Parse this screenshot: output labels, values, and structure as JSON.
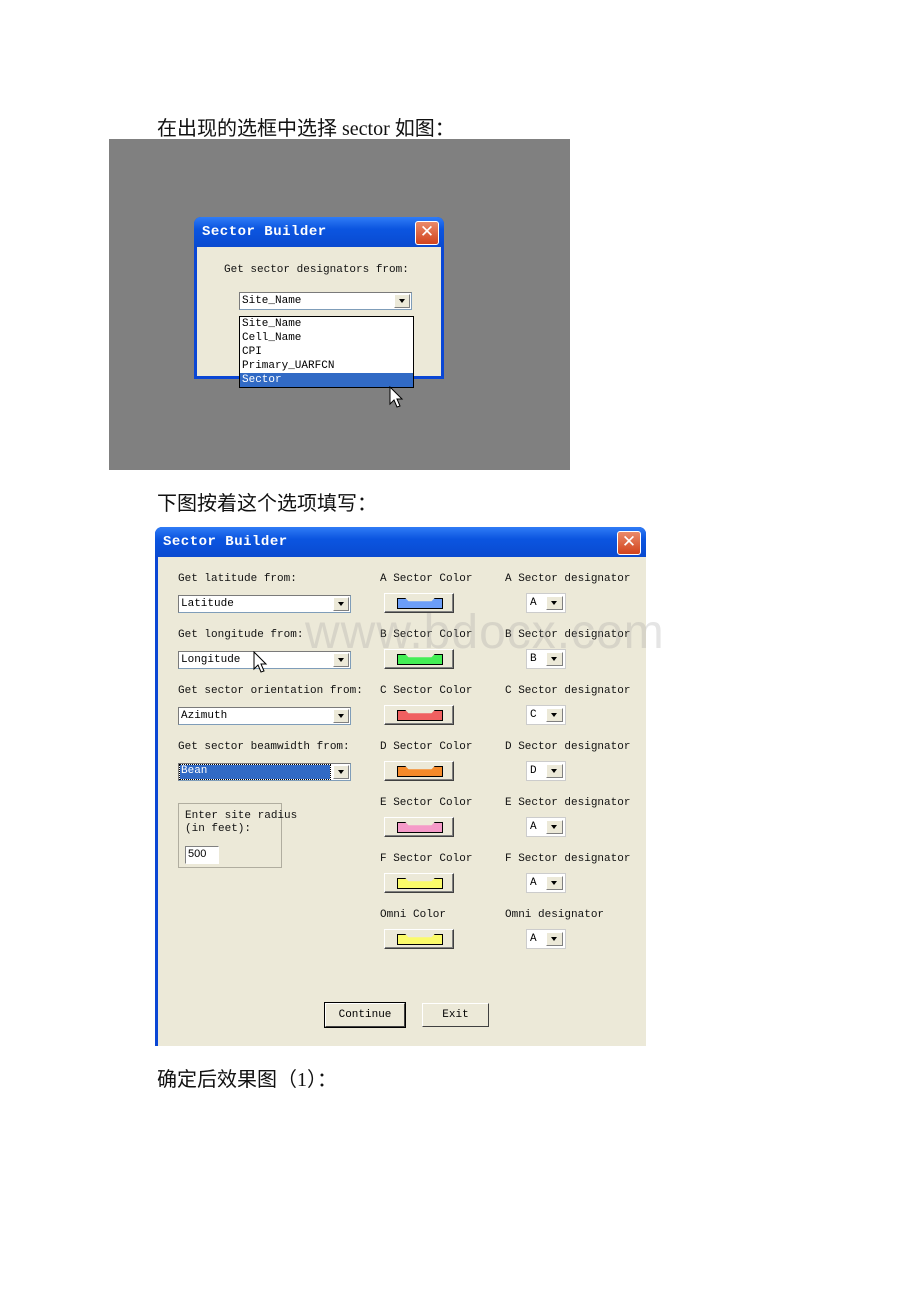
{
  "captions": {
    "intro": "在出现的选框中选择 sector 如图：",
    "fill": "下图按着这个选项填写：",
    "result": "确定后效果图（1）："
  },
  "dialog1": {
    "title": "Sector Builder",
    "close_icon": "close-icon",
    "label": "Get sector designators from:",
    "combo_value": "Site_Name",
    "options": [
      "Site_Name",
      "Cell_Name",
      "CPI",
      "Primary_UARFCN",
      "Sector"
    ],
    "highlighted": "Sector"
  },
  "dialog2": {
    "title": "Sector Builder",
    "close_icon": "close-icon",
    "left": {
      "latitude_label": "Get latitude from:",
      "latitude_value": "Latitude",
      "longitude_label": "Get longitude from:",
      "longitude_value": "Longitude",
      "orientation_label": "Get sector orientation from:",
      "orientation_value": "Azimuth",
      "beamwidth_label": "Get sector beamwidth from:",
      "beamwidth_value": "Bean",
      "radius_label_1": "Enter site radius",
      "radius_label_2": "(in feet):",
      "radius_value": "500"
    },
    "sectors": [
      {
        "color_label": "A Sector Color",
        "color": "#6c9ef8",
        "designator_label": "A Sector designator",
        "designator": "A"
      },
      {
        "color_label": "B Sector Color",
        "color": "#44ee55",
        "designator_label": "B Sector designator",
        "designator": "B"
      },
      {
        "color_label": "C Sector Color",
        "color": "#f06060",
        "designator_label": "C Sector designator",
        "designator": "C"
      },
      {
        "color_label": "D Sector Color",
        "color": "#f58a2a",
        "designator_label": "D Sector designator",
        "designator": "D"
      },
      {
        "color_label": "E Sector Color",
        "color": "#f59ac8",
        "designator_label": "E Sector designator",
        "designator": "A"
      },
      {
        "color_label": "F Sector Color",
        "color": "#fbfb6a",
        "designator_label": "F Sector designator",
        "designator": "A"
      },
      {
        "color_label": "Omni Color",
        "color": "#fbfb6a",
        "designator_label": "Omni designator",
        "designator": "A"
      }
    ],
    "buttons": {
      "continue": "Continue",
      "exit": "Exit"
    }
  },
  "watermark": "www.bdocx.com"
}
